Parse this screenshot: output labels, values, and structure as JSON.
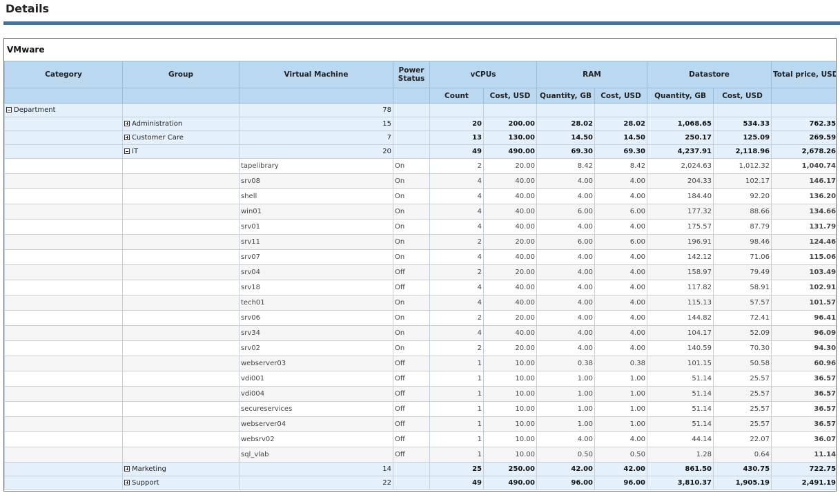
{
  "page": {
    "title": "Details"
  },
  "panel": {
    "title": "VMware"
  },
  "columns": {
    "category": "Category",
    "group": "Group",
    "virtual_machine": "Virtual Machine",
    "power_status": "Power Status",
    "vcpus": "vCPUs",
    "ram": "RAM",
    "datastore": "Datastore",
    "total_price": "Total price, USD",
    "vcpu_count": "Count",
    "vcpu_cost": "Cost, USD",
    "ram_qty": "Quantity, GB",
    "ram_cost": "Cost, USD",
    "ds_qty": "Quantity, GB",
    "ds_cost": "Cost, USD"
  },
  "department": {
    "label": "Department",
    "vm_count": "78"
  },
  "groups_before": [
    {
      "name": "Administration",
      "vm_count": "15",
      "vcpu_count": "20",
      "vcpu_cost": "200.00",
      "ram_qty": "28.02",
      "ram_cost": "28.02",
      "ds_qty": "1,068.65",
      "ds_cost": "534.33",
      "total": "762.35"
    },
    {
      "name": "Customer Care",
      "vm_count": "7",
      "vcpu_count": "13",
      "vcpu_cost": "130.00",
      "ram_qty": "14.50",
      "ram_cost": "14.50",
      "ds_qty": "250.17",
      "ds_cost": "125.09",
      "total": "269.59"
    }
  ],
  "it_group": {
    "name": "IT",
    "vm_count": "20",
    "vcpu_count": "49",
    "vcpu_cost": "490.00",
    "ram_qty": "69.30",
    "ram_cost": "69.30",
    "ds_qty": "4,237.91",
    "ds_cost": "2,118.96",
    "total": "2,678.26"
  },
  "vms": [
    {
      "name": "tapelibrary",
      "power": "On",
      "vcpu_count": "2",
      "vcpu_cost": "20.00",
      "ram_qty": "8.42",
      "ram_cost": "8.42",
      "ds_qty": "2,024.63",
      "ds_cost": "1,012.32",
      "total": "1,040.74"
    },
    {
      "name": "srv08",
      "power": "On",
      "vcpu_count": "4",
      "vcpu_cost": "40.00",
      "ram_qty": "4.00",
      "ram_cost": "4.00",
      "ds_qty": "204.33",
      "ds_cost": "102.17",
      "total": "146.17"
    },
    {
      "name": "shell",
      "power": "On",
      "vcpu_count": "4",
      "vcpu_cost": "40.00",
      "ram_qty": "4.00",
      "ram_cost": "4.00",
      "ds_qty": "184.40",
      "ds_cost": "92.20",
      "total": "136.20"
    },
    {
      "name": "win01",
      "power": "On",
      "vcpu_count": "4",
      "vcpu_cost": "40.00",
      "ram_qty": "6.00",
      "ram_cost": "6.00",
      "ds_qty": "177.32",
      "ds_cost": "88.66",
      "total": "134.66"
    },
    {
      "name": "srv01",
      "power": "On",
      "vcpu_count": "4",
      "vcpu_cost": "40.00",
      "ram_qty": "4.00",
      "ram_cost": "4.00",
      "ds_qty": "175.57",
      "ds_cost": "87.79",
      "total": "131.79"
    },
    {
      "name": "srv11",
      "power": "On",
      "vcpu_count": "2",
      "vcpu_cost": "20.00",
      "ram_qty": "6.00",
      "ram_cost": "6.00",
      "ds_qty": "196.91",
      "ds_cost": "98.46",
      "total": "124.46"
    },
    {
      "name": "srv07",
      "power": "On",
      "vcpu_count": "4",
      "vcpu_cost": "40.00",
      "ram_qty": "4.00",
      "ram_cost": "4.00",
      "ds_qty": "142.12",
      "ds_cost": "71.06",
      "total": "115.06"
    },
    {
      "name": "srv04",
      "power": "Off",
      "vcpu_count": "2",
      "vcpu_cost": "20.00",
      "ram_qty": "4.00",
      "ram_cost": "4.00",
      "ds_qty": "158.97",
      "ds_cost": "79.49",
      "total": "103.49"
    },
    {
      "name": "srv18",
      "power": "Off",
      "vcpu_count": "4",
      "vcpu_cost": "40.00",
      "ram_qty": "4.00",
      "ram_cost": "4.00",
      "ds_qty": "117.82",
      "ds_cost": "58.91",
      "total": "102.91"
    },
    {
      "name": "tech01",
      "power": "On",
      "vcpu_count": "4",
      "vcpu_cost": "40.00",
      "ram_qty": "4.00",
      "ram_cost": "4.00",
      "ds_qty": "115.13",
      "ds_cost": "57.57",
      "total": "101.57"
    },
    {
      "name": "srv06",
      "power": "On",
      "vcpu_count": "2",
      "vcpu_cost": "20.00",
      "ram_qty": "4.00",
      "ram_cost": "4.00",
      "ds_qty": "144.82",
      "ds_cost": "72.41",
      "total": "96.41"
    },
    {
      "name": "srv34",
      "power": "On",
      "vcpu_count": "4",
      "vcpu_cost": "40.00",
      "ram_qty": "4.00",
      "ram_cost": "4.00",
      "ds_qty": "104.17",
      "ds_cost": "52.09",
      "total": "96.09"
    },
    {
      "name": "srv02",
      "power": "On",
      "vcpu_count": "2",
      "vcpu_cost": "20.00",
      "ram_qty": "4.00",
      "ram_cost": "4.00",
      "ds_qty": "140.59",
      "ds_cost": "70.30",
      "total": "94.30"
    },
    {
      "name": "webserver03",
      "power": "Off",
      "vcpu_count": "1",
      "vcpu_cost": "10.00",
      "ram_qty": "0.38",
      "ram_cost": "0.38",
      "ds_qty": "101.15",
      "ds_cost": "50.58",
      "total": "60.96"
    },
    {
      "name": "vdi001",
      "power": "Off",
      "vcpu_count": "1",
      "vcpu_cost": "10.00",
      "ram_qty": "1.00",
      "ram_cost": "1.00",
      "ds_qty": "51.14",
      "ds_cost": "25.57",
      "total": "36.57"
    },
    {
      "name": "vdi004",
      "power": "Off",
      "vcpu_count": "1",
      "vcpu_cost": "10.00",
      "ram_qty": "1.00",
      "ram_cost": "1.00",
      "ds_qty": "51.14",
      "ds_cost": "25.57",
      "total": "36.57"
    },
    {
      "name": "secureservices",
      "power": "Off",
      "vcpu_count": "1",
      "vcpu_cost": "10.00",
      "ram_qty": "1.00",
      "ram_cost": "1.00",
      "ds_qty": "51.14",
      "ds_cost": "25.57",
      "total": "36.57"
    },
    {
      "name": "webserver04",
      "power": "Off",
      "vcpu_count": "1",
      "vcpu_cost": "10.00",
      "ram_qty": "1.00",
      "ram_cost": "1.00",
      "ds_qty": "51.14",
      "ds_cost": "25.57",
      "total": "36.57"
    },
    {
      "name": "websrv02",
      "power": "Off",
      "vcpu_count": "1",
      "vcpu_cost": "10.00",
      "ram_qty": "4.00",
      "ram_cost": "4.00",
      "ds_qty": "44.14",
      "ds_cost": "22.07",
      "total": "36.07"
    },
    {
      "name": "sql_vlab",
      "power": "Off",
      "vcpu_count": "1",
      "vcpu_cost": "10.00",
      "ram_qty": "0.50",
      "ram_cost": "0.50",
      "ds_qty": "1.28",
      "ds_cost": "0.64",
      "total": "11.14"
    }
  ],
  "groups_after": [
    {
      "name": "Marketing",
      "vm_count": "14",
      "vcpu_count": "25",
      "vcpu_cost": "250.00",
      "ram_qty": "42.00",
      "ram_cost": "42.00",
      "ds_qty": "861.50",
      "ds_cost": "430.75",
      "total": "722.75"
    },
    {
      "name": "Support",
      "vm_count": "22",
      "vcpu_count": "49",
      "vcpu_cost": "490.00",
      "ram_qty": "96.00",
      "ram_cost": "96.00",
      "ds_qty": "3,810.37",
      "ds_cost": "1,905.19",
      "total": "2,491.19"
    }
  ],
  "icons": {
    "expand": "plus-box-icon",
    "collapse": "minus-box-icon"
  },
  "colors": {
    "header_bg": "#bad9f1",
    "group_row_bg": "#e4f0fb",
    "title_rule": "#3a77a8"
  }
}
